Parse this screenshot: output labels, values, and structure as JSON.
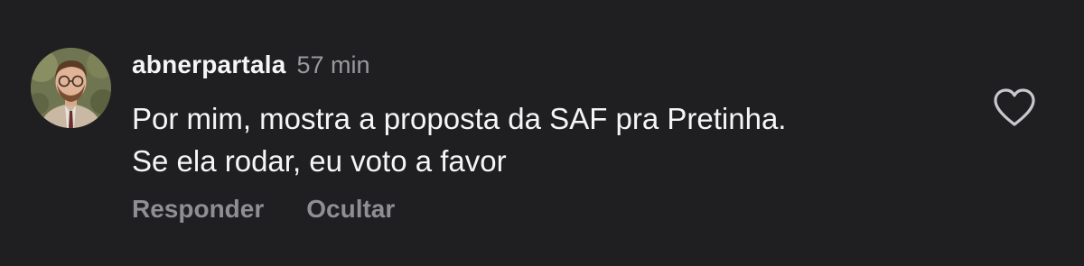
{
  "comment": {
    "username": "abnerpartala",
    "timestamp": "57 min",
    "text_lines": [
      "Por mim, mostra a proposta da SAF pra Pretinha.",
      "Se ela rodar, eu voto a favor"
    ],
    "actions": {
      "reply_label": "Responder",
      "hide_label": "Ocultar"
    },
    "icons": {
      "avatar": "user-avatar-photo",
      "like": "heart-outline-icon"
    }
  },
  "colors": {
    "background": "#1f1f22",
    "primary_text": "#f5f5f5",
    "secondary_text": "#9a9a9e",
    "action_text": "#8e8e93"
  }
}
